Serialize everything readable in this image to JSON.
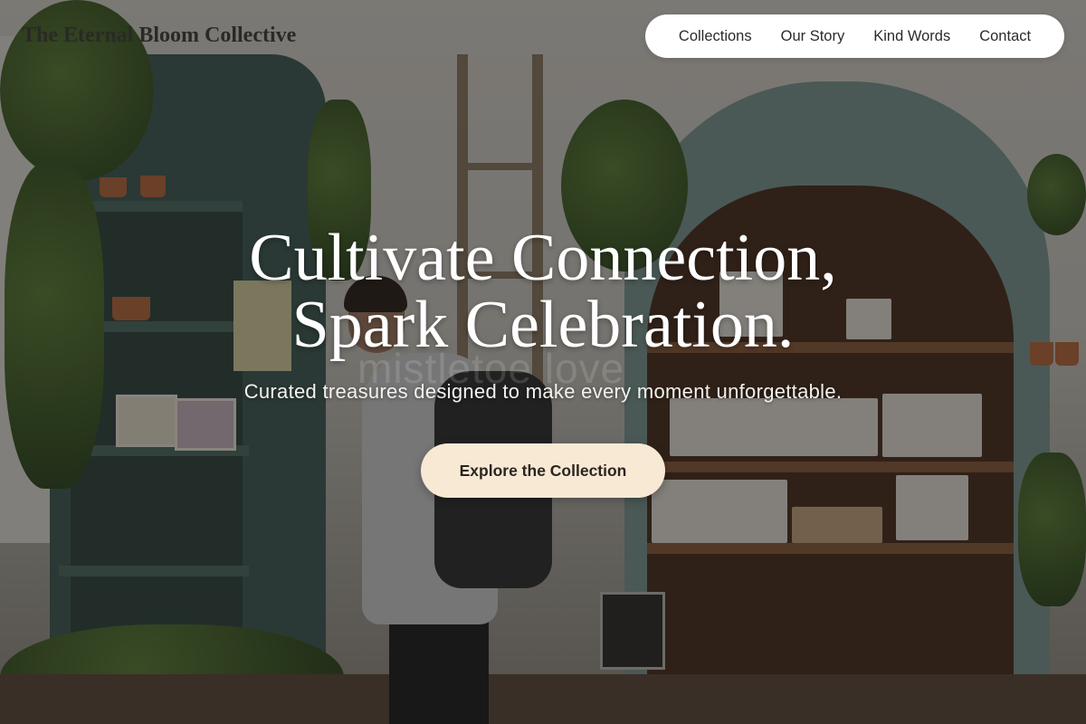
{
  "header": {
    "brand": "The Eternal Bloom Collective",
    "nav": [
      {
        "label": "Collections"
      },
      {
        "label": "Our Story"
      },
      {
        "label": "Kind Words"
      },
      {
        "label": "Contact"
      }
    ]
  },
  "hero": {
    "headline_line1": "Cultivate Connection,",
    "headline_line2": "Spark Celebration.",
    "subheadline": "Curated treasures designed to make every moment unforgettable.",
    "cta_label": "Explore the Collection",
    "background_sign_text": "mistletoe love"
  },
  "colors": {
    "cta_background": "#f7e9d4",
    "nav_background": "#ffffff",
    "headline_text": "#ffffff"
  }
}
